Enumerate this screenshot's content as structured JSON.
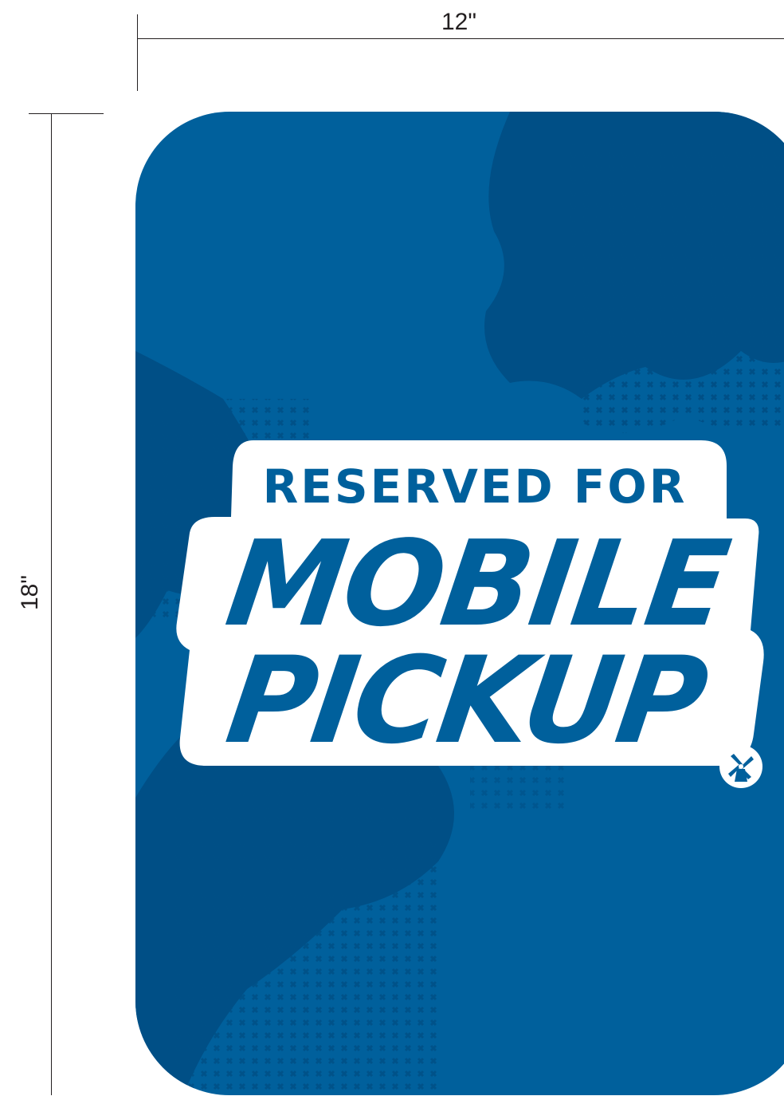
{
  "dimensions": {
    "width_label": "12\"",
    "height_label": "18\""
  },
  "sign": {
    "line1": "RESERVED FOR",
    "line2": "MOBILE",
    "line3": "PICKUP",
    "logo_icon": "windmill-icon",
    "colors": {
      "background": "#00609c",
      "texture": "#004f86",
      "text": "#00609c",
      "outline": "#ffffff"
    }
  }
}
